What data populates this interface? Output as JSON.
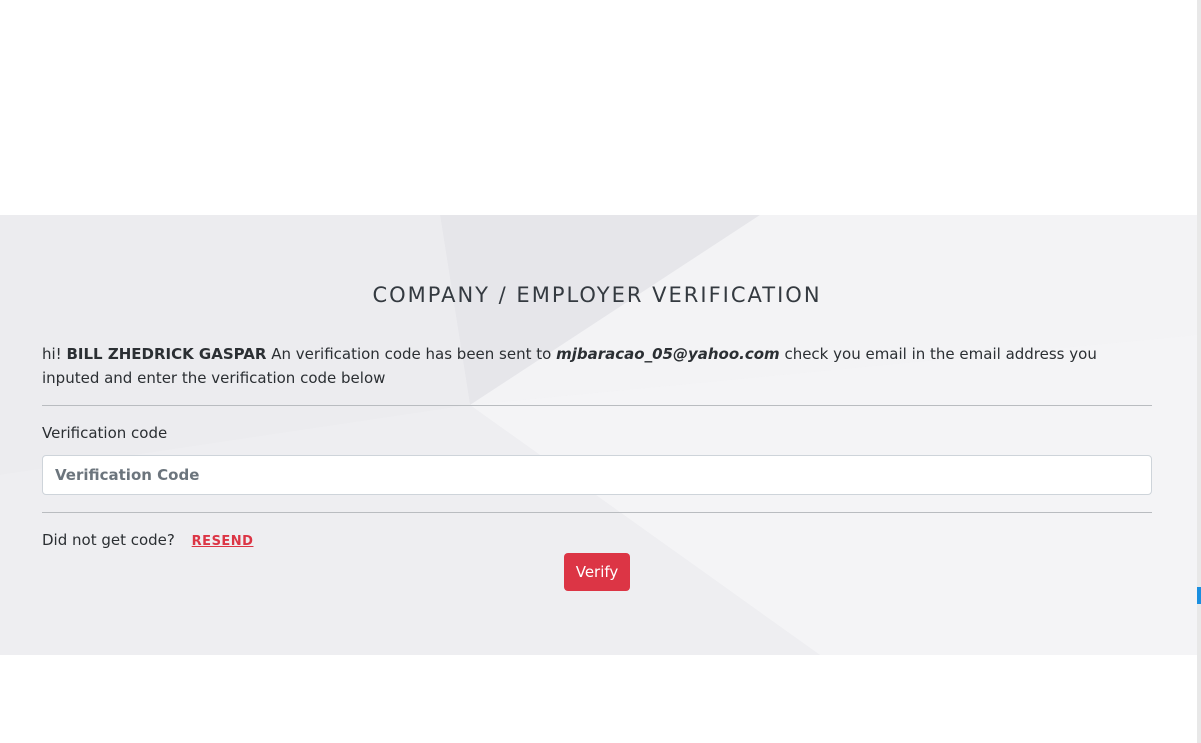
{
  "verification": {
    "title": "COMPANY / EMPLOYER VERIFICATION",
    "greeting": "hi!",
    "user_name": "BILL ZHEDRICK GASPAR",
    "message_part1": "An verification code has been sent to",
    "email": "mjbaracao_05@yahoo.com",
    "message_part2": "check you email in the email address you inputed and enter the verification code below",
    "field_label": "Verification code",
    "input_placeholder": "Verification Code",
    "input_value": "",
    "resend_prompt": "Did not get code?",
    "resend_label": "RESEND",
    "verify_label": "Verify"
  },
  "colors": {
    "accent": "#dc3545",
    "section_bg": "#efeff2",
    "scroll_thumb": "#1a8fe0"
  }
}
